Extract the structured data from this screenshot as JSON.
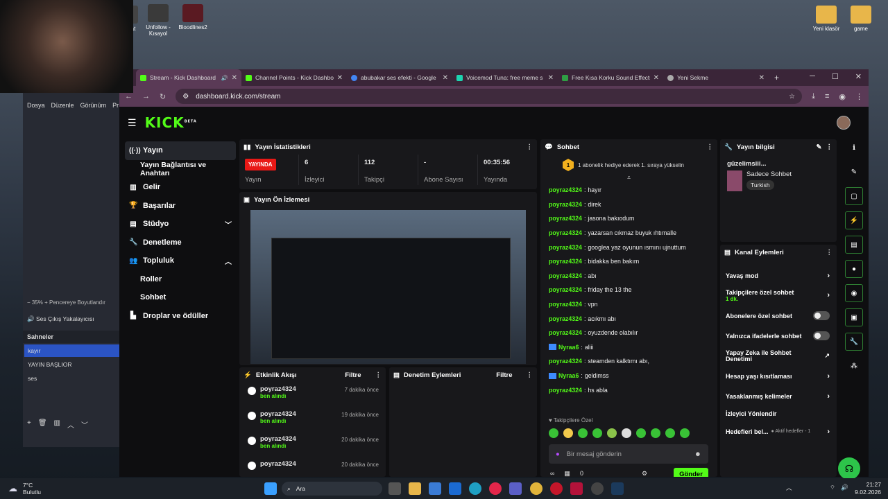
{
  "desktop": {
    "icons_left": [
      {
        "label": "at"
      },
      {
        "label": "Unfollow - Kısayol"
      },
      {
        "label": "Bloodlines2"
      }
    ],
    "icons_right": [
      {
        "label": "Yeni klasör"
      },
      {
        "label": "game"
      }
    ]
  },
  "obs": {
    "menu": [
      "Dosya",
      "Düzenle",
      "Görünüm",
      "Pr"
    ],
    "zoom_row": "−   35%   +   Pencereye Boyutlandır",
    "audio_source": "Ses Çıkış Yakalayıcısı",
    "scenes_title": "Sahneler",
    "scenes": [
      "kayır",
      "YAYIN BAŞLIOR",
      "ses"
    ]
  },
  "browser": {
    "tabs": [
      {
        "title": "Stream - Kick Dashboard",
        "color": "#53fc18"
      },
      {
        "title": "Channel Points - Kick Dashbo",
        "color": "#53fc18"
      },
      {
        "title": "abubakar ses efekti - Google",
        "color": "#4285f4"
      },
      {
        "title": "Voicemod Tuna: free meme s",
        "color": "#1dd3b0"
      },
      {
        "title": "Free Kısa Korku Sound Effects",
        "color": "#2f9e44"
      },
      {
        "title": "Yeni Sekme",
        "color": "#aaaaaa"
      }
    ],
    "url": "dashboard.kick.com/stream"
  },
  "kick": {
    "logo": "KICK",
    "logo_sup": "BETA",
    "sidebar": {
      "items": [
        {
          "label": "Yayın",
          "icon": "broadcast-icon"
        },
        {
          "label": "Yayın Bağlantısı ve Anahtarı"
        },
        {
          "label": "Gelir",
          "icon": "chart-icon"
        },
        {
          "label": "Başarılar",
          "icon": "trophy-icon"
        },
        {
          "label": "Stüdyo",
          "icon": "studio-icon"
        },
        {
          "label": "Denetleme",
          "icon": "wrench-icon"
        },
        {
          "label": "Topluluk",
          "icon": "people-icon"
        },
        {
          "label": "Roller"
        },
        {
          "label": "Sohbet"
        },
        {
          "label": "Droplar ve ödüller",
          "icon": "drops-icon"
        }
      ]
    },
    "stats": {
      "title": "Yayın İstatistikleri",
      "live_badge": "YAYINDA",
      "live_label": "Yayın",
      "cells": [
        {
          "value": "6",
          "label": "İzleyici"
        },
        {
          "value": "112",
          "label": "Takipçi"
        },
        {
          "value": "-",
          "label": "Abone Sayısı"
        },
        {
          "value": "00:35:56",
          "label": "Yayında"
        }
      ]
    },
    "preview": {
      "title": "Yayın Ön İzlemesi"
    },
    "activity": {
      "title": "Etkinlik Akışı",
      "filter": "Filtre",
      "items": [
        {
          "user": "poyraz4324",
          "detail": "ben alındı",
          "time": "7 dakika önce"
        },
        {
          "user": "poyraz4324",
          "detail": "ben alındı",
          "time": "19 dakika önce"
        },
        {
          "user": "poyraz4324",
          "detail": "ben alındı",
          "time": "20 dakika önce"
        },
        {
          "user": "poyraz4324",
          "detail": "",
          "time": "20 dakika önce"
        }
      ]
    },
    "moderation": {
      "title": "Denetim Eylemleri",
      "filter": "Filtre"
    },
    "chat": {
      "title": "Sohbet",
      "pinned_rank": "1",
      "pinned": "1 abonelik hediye ederek 1. sıraya yükselin",
      "messages": [
        {
          "user": "poyraz4324",
          "text": "hayır",
          "badge": false
        },
        {
          "user": "poyraz4324",
          "text": "direk",
          "badge": false
        },
        {
          "user": "poyraz4324",
          "text": "jasona bakıodum",
          "badge": false
        },
        {
          "user": "poyraz4324",
          "text": "yazarsan cıkmaz buyuk ıhtımalle",
          "badge": false
        },
        {
          "user": "poyraz4324",
          "text": "googlea yaz oyunun ısmını ujnuttum",
          "badge": false
        },
        {
          "user": "poyraz4324",
          "text": "bidakka ben bakım",
          "badge": false
        },
        {
          "user": "poyraz4324",
          "text": "abı",
          "badge": false
        },
        {
          "user": "poyraz4324",
          "text": "friday the 13 the",
          "badge": false
        },
        {
          "user": "poyraz4324",
          "text": "vpn",
          "badge": false
        },
        {
          "user": "poyraz4324",
          "text": "acıkmı abı",
          "badge": false
        },
        {
          "user": "poyraz4324",
          "text": "oyuzdende olabılır",
          "badge": false
        },
        {
          "user": "Nyraa6",
          "text": "aliii",
          "badge": true
        },
        {
          "user": "poyraz4324",
          "text": "steamden kalktımı abı,",
          "badge": false
        },
        {
          "user": "Nyraa6",
          "text": "geldimss",
          "badge": true
        },
        {
          "user": "poyraz4324",
          "text": "hs abla",
          "badge": false
        }
      ],
      "followers_label": "♥ Takipçilere Özel",
      "input_placeholder": "Bir mesaj gönderin",
      "send": "Gönder",
      "infinity": "∞",
      "count": "0"
    },
    "stream_info": {
      "title": "Yayın bilgisi",
      "stream_title": "güzelimsiii...",
      "category": "Sadece Sohbet",
      "language": "Turkish"
    },
    "channel_actions": {
      "title": "Kanal Eylemleri",
      "rows": [
        {
          "label": "Yavaş mod",
          "control": "chevron"
        },
        {
          "label": "Takipçilere özel sohbet",
          "sub": "1 dk.",
          "control": "chevron"
        },
        {
          "label": "Abonelere özel sohbet",
          "control": "toggle"
        },
        {
          "label": "Yalnızca ifadelerle sohbet",
          "control": "toggle"
        },
        {
          "label": "Yapay Zeka ile Sohbet Denetimi",
          "control": "link"
        },
        {
          "label": "Hesap yaşı kısıtlaması",
          "control": "chevron"
        },
        {
          "label": "Yasaklanmış kelimeler",
          "control": "chevron"
        },
        {
          "label": "İzleyici Yönlendir",
          "control": "none"
        },
        {
          "label": "Hedefleri bel...",
          "sub": "● Aktif hedefler - 1",
          "control": "chevron"
        }
      ]
    }
  },
  "taskbar": {
    "weather_temp": "7°C",
    "weather_desc": "Bulutlu",
    "search": "Ara",
    "time": "21:27",
    "date": "9.02.2026"
  }
}
